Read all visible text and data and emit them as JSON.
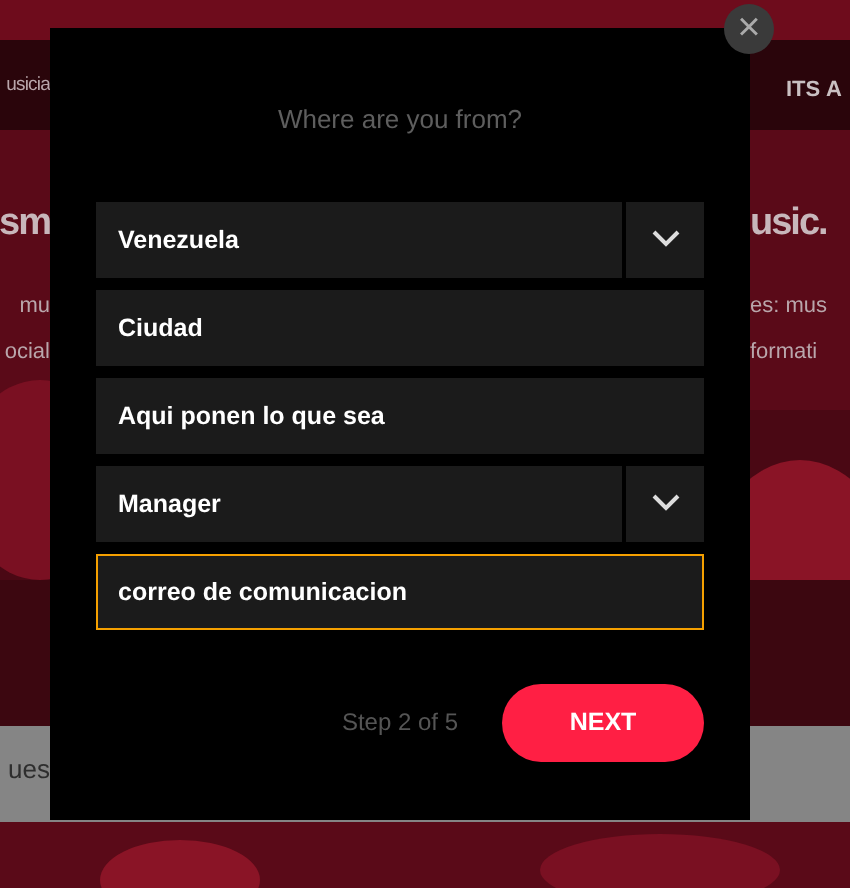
{
  "background": {
    "left": [
      "usicia",
      "sm",
      "mu",
      "ocial",
      "ues"
    ],
    "right_nav": [
      "ITS",
      "A"
    ],
    "right": [
      "usic.",
      "es: mus",
      "formati"
    ]
  },
  "modal": {
    "close": "×",
    "title": "Where are you from?",
    "fields": [
      {
        "kind": "select",
        "value": "Venezuela",
        "focused": false
      },
      {
        "kind": "text",
        "value": "Ciudad",
        "focused": false
      },
      {
        "kind": "text",
        "value": "Aqui ponen lo que sea",
        "focused": false
      },
      {
        "kind": "select",
        "value": "Manager",
        "focused": false
      },
      {
        "kind": "text",
        "value": "correo de comunicacion",
        "focused": true
      }
    ],
    "step": "Step 2 of 5",
    "next": "NEXT"
  }
}
